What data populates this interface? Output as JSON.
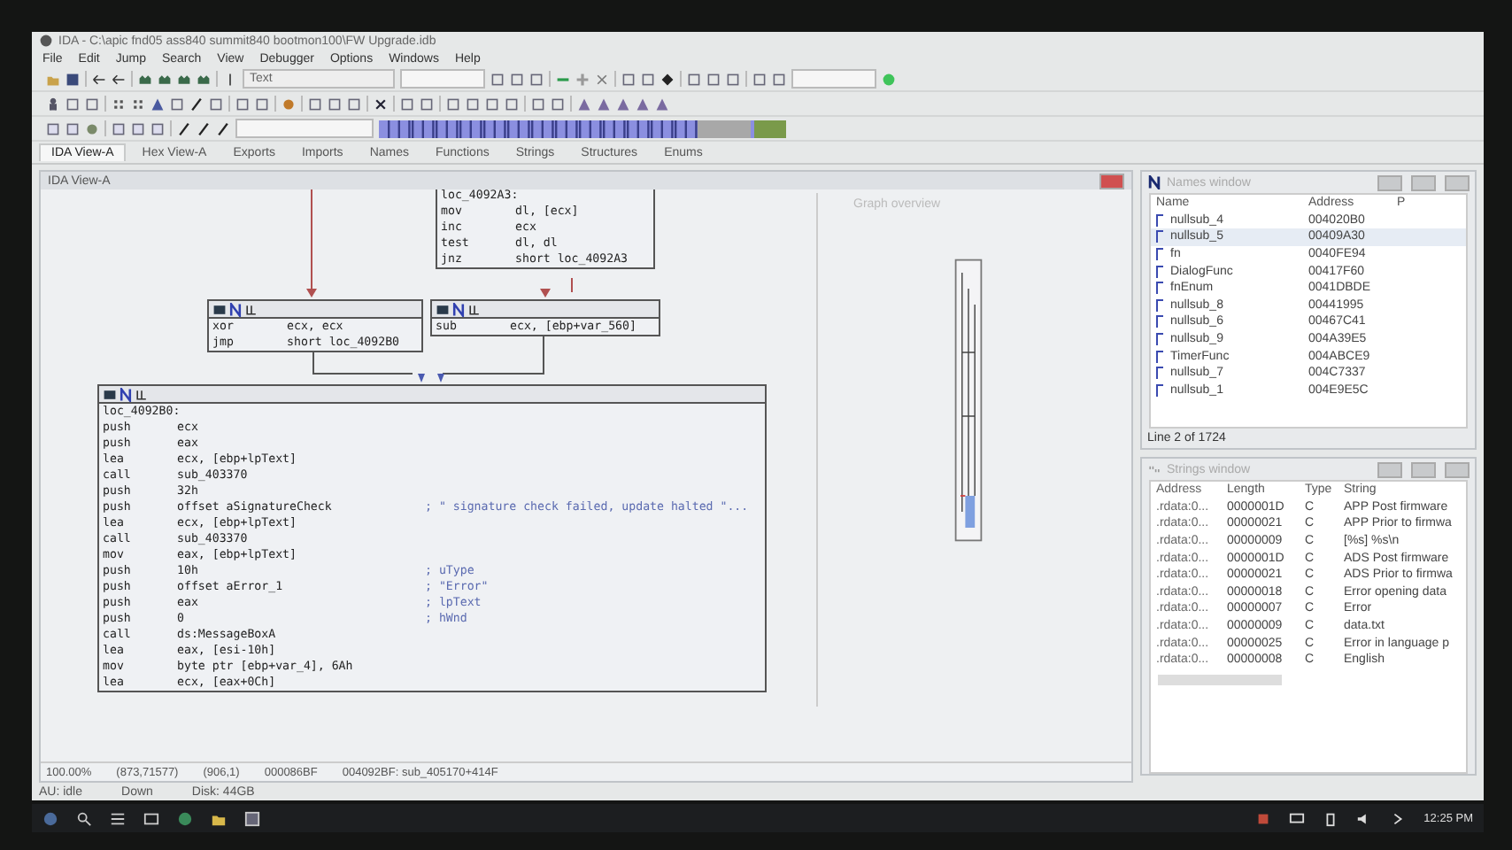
{
  "window": {
    "title": "IDA - C:\\apic fnd05 ass840 summit840 bootmon100\\FW Upgrade.idb"
  },
  "menu": [
    "File",
    "Edit",
    "Jump",
    "Search",
    "View",
    "Debugger",
    "Options",
    "Windows",
    "Help"
  ],
  "toolbar": {
    "dropdown": "Text"
  },
  "tabs": [
    {
      "label": "IDA View-A",
      "selected": true
    },
    {
      "label": "Hex View-A",
      "selected": false
    },
    {
      "label": "Exports",
      "selected": false
    },
    {
      "label": "Imports",
      "selected": false
    },
    {
      "label": "Names",
      "selected": false
    },
    {
      "label": "Functions",
      "selected": false
    },
    {
      "label": "Strings",
      "selected": false
    },
    {
      "label": "Structures",
      "selected": false
    },
    {
      "label": "Enums",
      "selected": false
    }
  ],
  "ida_view": {
    "title": "IDA View-A",
    "overview_title": "Graph overview",
    "blocks": [
      {
        "header": false,
        "lines": [
          {
            "op": "loc_4092A3:"
          },
          {
            "op": "mov",
            "args": "dl, [ecx]"
          },
          {
            "op": "inc",
            "args": "ecx"
          },
          {
            "op": "test",
            "args": "dl, dl"
          },
          {
            "op": "jnz",
            "args": "short loc_4092A3"
          }
        ]
      },
      {
        "header": true,
        "lines": [
          {
            "op": "xor",
            "args": "ecx, ecx"
          },
          {
            "op": "jmp",
            "args": "short loc_4092B0"
          }
        ]
      },
      {
        "header": true,
        "lines": [
          {
            "op": "sub",
            "args": "ecx, [ebp+var_560]"
          }
        ]
      },
      {
        "header": true,
        "lines": [
          {
            "op": "loc_4092B0:"
          },
          {
            "op": "push",
            "args": "ecx"
          },
          {
            "op": "push",
            "args": "eax"
          },
          {
            "op": "lea",
            "args": "ecx, [ebp+lpText]"
          },
          {
            "op": "call",
            "args": "sub_403370"
          },
          {
            "op": "push",
            "args": "32h"
          },
          {
            "op": "push",
            "args": "offset aSignatureCheck",
            "comment": "; \" signature check failed, update halted \"..."
          },
          {
            "op": "lea",
            "args": "ecx, [ebp+lpText]"
          },
          {
            "op": "call",
            "args": "sub_403370"
          },
          {
            "op": "mov",
            "args": "eax, [ebp+lpText]"
          },
          {
            "op": "push",
            "args": "10h",
            "comment": "; uType"
          },
          {
            "op": "push",
            "args": "offset aError_1",
            "comment": "; \"Error\""
          },
          {
            "op": "push",
            "args": "eax",
            "comment": "; lpText"
          },
          {
            "op": "push",
            "args": "0",
            "comment": "; hWnd"
          },
          {
            "op": "call",
            "args": "ds:MessageBoxA"
          },
          {
            "op": "lea",
            "args": "eax, [esi-10h]"
          },
          {
            "op": "mov",
            "args": "byte ptr [ebp+var_4], 6Ah"
          },
          {
            "op": "lea",
            "args": "ecx, [eax+0Ch]"
          }
        ]
      }
    ],
    "status": [
      "100.00%",
      "(873,71577)",
      "(906,1)",
      "000086BF",
      "004092BF: sub_405170+414F"
    ]
  },
  "names_window": {
    "title": "Names window",
    "columns": [
      "Name",
      "Address",
      "P"
    ],
    "rows": [
      {
        "name": "nullsub_4",
        "address": "004020B0",
        "selected": false
      },
      {
        "name": "nullsub_5",
        "address": "00409A30",
        "selected": true
      },
      {
        "name": "fn",
        "address": "0040FE94",
        "selected": false
      },
      {
        "name": "DialogFunc",
        "address": "00417F60",
        "selected": false
      },
      {
        "name": "fnEnum",
        "address": "0041DBDE",
        "selected": false
      },
      {
        "name": "nullsub_8",
        "address": "00441995",
        "selected": false
      },
      {
        "name": "nullsub_6",
        "address": "00467C41",
        "selected": false
      },
      {
        "name": "nullsub_9",
        "address": "004A39E5",
        "selected": false
      },
      {
        "name": "TimerFunc",
        "address": "004ABCE9",
        "selected": false
      },
      {
        "name": "nullsub_7",
        "address": "004C7337",
        "selected": false
      },
      {
        "name": "nullsub_1",
        "address": "004E9E5C",
        "selected": false
      }
    ],
    "footer": "Line 2 of 1724"
  },
  "strings_window": {
    "title": "Strings window",
    "columns": [
      "Address",
      "Length",
      "Type",
      "String"
    ],
    "rows": [
      {
        "address": ".rdata:0...",
        "length": "0000001D",
        "type": "C",
        "string": "APP Post firmware"
      },
      {
        "address": ".rdata:0...",
        "length": "00000021",
        "type": "C",
        "string": "APP Prior to firmwa"
      },
      {
        "address": ".rdata:0...",
        "length": "00000009",
        "type": "C",
        "string": "[%s] %s\\n"
      },
      {
        "address": ".rdata:0...",
        "length": "0000001D",
        "type": "C",
        "string": "ADS Post firmware"
      },
      {
        "address": ".rdata:0...",
        "length": "00000021",
        "type": "C",
        "string": "ADS Prior to firmwa"
      },
      {
        "address": ".rdata:0...",
        "length": "00000018",
        "type": "C",
        "string": "Error opening data"
      },
      {
        "address": ".rdata:0...",
        "length": "00000007",
        "type": "C",
        "string": "Error"
      },
      {
        "address": ".rdata:0...",
        "length": "00000009",
        "type": "C",
        "string": "data.txt"
      },
      {
        "address": ".rdata:0...",
        "length": "00000025",
        "type": "C",
        "string": "Error in language p"
      },
      {
        "address": ".rdata:0...",
        "length": "00000008",
        "type": "C",
        "string": "English"
      }
    ]
  },
  "status_bar": [
    "AU: idle",
    "Down",
    "Disk: 44GB"
  ],
  "taskbar": {
    "time": "12:25 PM"
  }
}
